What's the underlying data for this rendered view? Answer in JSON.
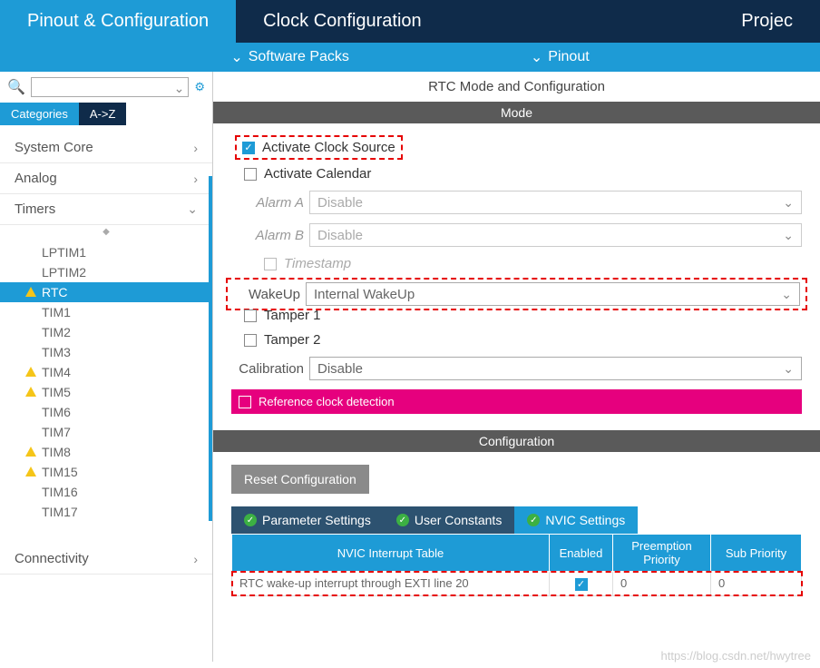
{
  "topTabs": {
    "pinout": "Pinout & Configuration",
    "clock": "Clock Configuration",
    "project": "Projec"
  },
  "subBar": {
    "software": "Software Packs",
    "pinout": "Pinout"
  },
  "sidebar": {
    "catTab": "Categories",
    "azTab": "A->Z",
    "groups": {
      "system": "System Core",
      "analog": "Analog",
      "timers": "Timers",
      "connectivity": "Connectivity"
    },
    "timerItems": [
      "LPTIM1",
      "LPTIM2",
      "RTC",
      "TIM1",
      "TIM2",
      "TIM3",
      "TIM4",
      "TIM5",
      "TIM6",
      "TIM7",
      "TIM8",
      "TIM15",
      "TIM16",
      "TIM17"
    ]
  },
  "content": {
    "title": "RTC Mode and Configuration",
    "modeHeader": "Mode",
    "activateClock": "Activate Clock Source",
    "activateCalendar": "Activate Calendar",
    "alarmA": "Alarm A",
    "alarmB": "Alarm B",
    "disable": "Disable",
    "timestamp": "Timestamp",
    "wakeup": "WakeUp",
    "wakeupVal": "Internal WakeUp",
    "tamper1": "Tamper 1",
    "tamper2": "Tamper 2",
    "calibration": "Calibration",
    "refClock": "Reference clock detection",
    "configHeader": "Configuration",
    "resetBtn": "Reset Configuration",
    "tabs": {
      "param": "Parameter Settings",
      "user": "User Constants",
      "nvic": "NVIC Settings"
    },
    "nvicCols": {
      "table": "NVIC Interrupt Table",
      "enabled": "Enabled",
      "preempt": "Preemption Priority",
      "sub": "Sub Priority"
    },
    "nvicRow": {
      "name": "RTC wake-up interrupt through EXTI line 20",
      "preempt": "0",
      "sub": "0"
    }
  },
  "watermark": "https://blog.csdn.net/hwytree"
}
